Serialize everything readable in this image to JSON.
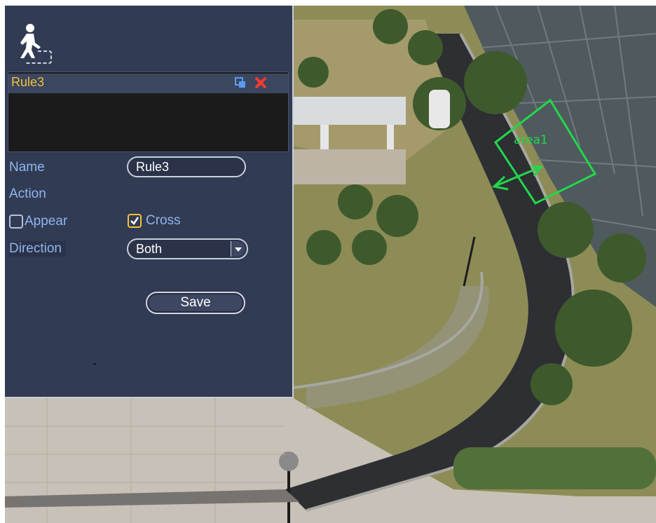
{
  "panel": {
    "rules": [
      {
        "name": "Rule3"
      }
    ],
    "name_label": "Name",
    "name_value": "Rule3",
    "action_label": "Action",
    "appear_label": "Appear",
    "appear_checked": false,
    "cross_label": "Cross",
    "cross_checked": true,
    "direction_label": "Direction",
    "direction_value": "Both",
    "save_label": "Save"
  },
  "overlay": {
    "area_label": "area1",
    "line_color": "#22d84b"
  },
  "icons": {
    "rule_type": "person-crossing-icon",
    "copy": "copy-icon",
    "delete": "delete-icon",
    "dropdown": "chevron-down-icon",
    "check": "checkmark-icon"
  },
  "colors": {
    "panel_bg": "#313b53",
    "label": "#8fb6ee",
    "rule_name": "#f2c23b",
    "delete": "#ff3b2f",
    "checkbox_checked": "#f2c23b"
  }
}
